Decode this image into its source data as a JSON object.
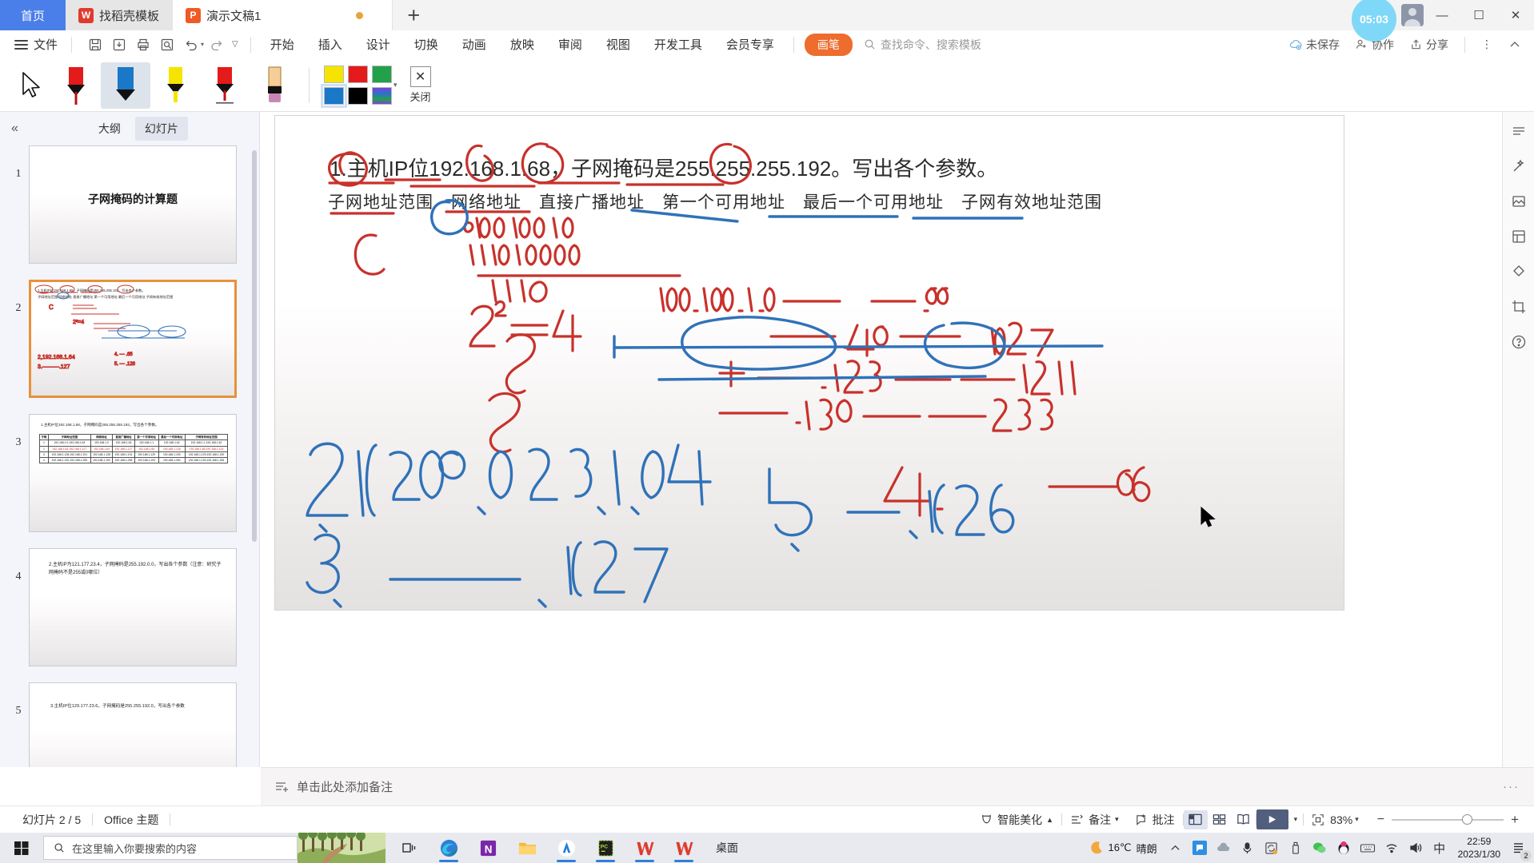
{
  "window": {
    "tabs": [
      {
        "label": "首页",
        "icon": "home-tab",
        "state": "home"
      },
      {
        "label": "找稻壳模板",
        "icon": "docer-icon",
        "state": "inactive"
      },
      {
        "label": "演示文稿1",
        "icon": "ppt-icon",
        "state": "active"
      }
    ],
    "new_tab_label": "+",
    "controls": {
      "minimize": "—",
      "maximize": "☐",
      "close": "✕"
    }
  },
  "menubar": {
    "file_label": "文件",
    "quick_access": [
      "save-icon",
      "save-as-icon",
      "print-icon",
      "print-preview-icon",
      "undo-icon",
      "redo-icon",
      "customize-icon"
    ],
    "items": [
      "开始",
      "插入",
      "设计",
      "切换",
      "动画",
      "放映",
      "审阅",
      "视图",
      "开发工具",
      "会员专享"
    ],
    "pen_tab": "画笔",
    "search_placeholder": "查找命令、搜索模板",
    "right_items": [
      {
        "label": "未保存",
        "icon": "cloud-unsaved-icon"
      },
      {
        "label": "协作",
        "icon": "collaborate-icon"
      },
      {
        "label": "分享",
        "icon": "share-icon"
      }
    ],
    "more_icon": "more-vertical-icon",
    "collapse_ribbon_icon": "chevron-up-icon"
  },
  "pen_ribbon": {
    "cursor_tool": "select-cursor",
    "pens": [
      {
        "name": "red-pen",
        "body": "#e51a1a",
        "tip": "#111111",
        "selected": false
      },
      {
        "name": "blue-highlighter",
        "body": "#1a78c8",
        "tip": "#111111",
        "selected": true
      },
      {
        "name": "yellow-highlighter",
        "body": "#f5e400",
        "tip": "#111111",
        "selected": false
      },
      {
        "name": "red-ballpoint",
        "body": "#e51a1a",
        "tip": "#111111",
        "selected": false
      },
      {
        "name": "eraser",
        "body": "#f5ce9a",
        "tip": "#c987b8",
        "selected": false
      }
    ],
    "colors": [
      {
        "name": "yellow",
        "hex": "#f5e400",
        "selected": false
      },
      {
        "name": "red",
        "hex": "#e51a1a",
        "selected": false
      },
      {
        "name": "green",
        "hex": "#22a14a",
        "selected": false
      },
      {
        "name": "blue",
        "hex": "#1a78c8",
        "selected": true
      },
      {
        "name": "black",
        "hex": "#000000",
        "selected": false
      },
      {
        "name": "rainbow",
        "hex": "#7a43d6",
        "selected": false
      }
    ],
    "more_colors_icon": "chevron-down-icon",
    "close_label": "关闭",
    "close_icon": "close-x-icon"
  },
  "left_panel": {
    "collapse_icon": "chevron-double-left-icon",
    "tabs": [
      {
        "label": "大纲",
        "active": false
      },
      {
        "label": "幻灯片",
        "active": true
      }
    ],
    "add_slide_label": "+",
    "slides": [
      {
        "number": "1",
        "selected": false,
        "title": "子网掩码的计算题",
        "kind": "title"
      },
      {
        "number": "2",
        "selected": true,
        "kind": "ink",
        "line1": "1.主机IP位192.168.1.68，子网掩码是255.255.255.192。写出各个参数。",
        "line2": "子网地址范围  网络地址  直接广播地址  第一个可用地址  最后一个可用地址  子网有效地址范围"
      },
      {
        "number": "3",
        "selected": false,
        "kind": "table",
        "heading": "1.主机IP位192.168.1.68，子网掩码是255.255.255.192。写出各个参数。",
        "columns": [
          "子网",
          "子网地址范围",
          "网络地址",
          "直接广播地址",
          "第一个可用地址",
          "最后一个可用地址",
          "子网有效地址范围"
        ],
        "rows": [
          [
            "1",
            "192.168.1.0-192.168.1.63",
            "192.168.1.0",
            "192.168.1.63",
            "192.168.1.1",
            "192.168.1.62",
            "192.168.1.1-192.168.1.62"
          ],
          [
            "2",
            "192.168.1.64-192.168.1.127",
            "192.168.1.64",
            "192.168.1.127",
            "192.168.1.65",
            "192.168.1.126",
            "192.168.1.65-192.168.1.126"
          ],
          [
            "3",
            "192.168.1.128-192.168.1.191",
            "192.168.1.128",
            "192.168.1.191",
            "192.168.1.129",
            "192.168.1.190",
            "192.168.1.129-192.168.1.190"
          ],
          [
            "4",
            "192.168.1.192-192.168.1.255",
            "192.168.1.192",
            "192.168.1.255",
            "192.168.1.193",
            "192.168.1.254",
            "192.168.1.193-192.168.1.254"
          ]
        ],
        "highlight_row_index": 1
      },
      {
        "number": "4",
        "selected": false,
        "kind": "text",
        "body": "2.主机IP为121.177.23.4，子网掩码是255.192.0.0，写出各个参数（注意：研究子网掩码不是255或0哪位）"
      },
      {
        "number": "5",
        "selected": false,
        "kind": "text",
        "body": "3.主机IP位129.177.23.6，子网掩码是255.255.192.0，写出各个参数"
      }
    ]
  },
  "slide": {
    "line1": "1.主机IP位192.168.1.68，子网掩码是255.255.255.192。写出各个参数。",
    "line2": "子网地址范围　网络地址　直接广播地址　第一个可用地址　最后一个可用地址　子网有效地址范围",
    "ink_notes": {
      "class_letter": "C",
      "binary_1": "01000100",
      "binary_2": "11000000",
      "power_expr": "2²=4",
      "range_top": "192.168.1.0 —  — .63",
      "mark_64": "— .64",
      "mark_127": ".127",
      "mark_128": "+ — .128 — — .191",
      "mark_192": "— .192 — — — .255",
      "answer2": "2,192.168.1.64",
      "answer3": "3. ——— .127",
      "answer4": "4.  ——— .65",
      "answer5": "5.  — .126"
    }
  },
  "right_rail": {
    "icons": [
      "panel-icon",
      "magic-wand-icon",
      "image-frame-icon",
      "layout-icon",
      "shapes-icon",
      "crop-icon",
      "help-icon"
    ]
  },
  "notes_bar": {
    "icon": "notes-icon",
    "placeholder": "单击此处添加备注",
    "more_icon": "more-horizontal-icon"
  },
  "status_bar": {
    "slide_counter": "幻灯片 2 / 5",
    "theme": "Office 主题",
    "beautify_label": "智能美化",
    "beautify_caret": "▲",
    "notes_label": "备注",
    "comment_label": "批注",
    "view_buttons": [
      {
        "name": "normal-view",
        "active": true
      },
      {
        "name": "slide-sorter-view",
        "active": false
      },
      {
        "name": "reading-view",
        "active": false
      }
    ],
    "play_icon": "play-icon",
    "fit_icon": "fit-to-window-icon",
    "zoom_level": "83%",
    "zoom_minus": "−",
    "zoom_plus": "+"
  },
  "taskbar": {
    "start_icon": "windows-start-icon",
    "search_placeholder": "在这里输入你要搜索的内容",
    "task_view_icon": "task-view-icon",
    "apps": [
      {
        "name": "edge-icon",
        "running": true
      },
      {
        "name": "onenote-icon",
        "running": false
      },
      {
        "name": "file-explorer-icon",
        "running": false
      },
      {
        "name": "app-blue-icon",
        "running": true
      },
      {
        "name": "pc-manager-icon",
        "running": true
      },
      {
        "name": "wps-writer-icon",
        "running": true
      },
      {
        "name": "wps-presentation-icon",
        "running": true
      }
    ],
    "desktop_label": "桌面",
    "weather_temp": "16℃",
    "weather_text": "晴朗",
    "tray_expand_icon": "chevron-up-icon",
    "tray_icons": [
      "chat-icon",
      "cloud-icon",
      "mic-icon",
      "sync-icon",
      "usb-icon",
      "wechat-icon",
      "qq-icon",
      "keyboard-icon",
      "wifi-icon",
      "volume-icon"
    ],
    "ime_label": "中",
    "clock_time": "22:59",
    "clock_date": "2023/1/30",
    "notification_icon": "notification-icon",
    "notification_count": "2"
  },
  "overlay": {
    "timer_label": "05:03",
    "avatar": "user-avatar"
  },
  "colors": {
    "accent_blue": "#4a7ee8",
    "pen_orange": "#ee6c2d",
    "selection_orange": "#e8913a",
    "ink_red": "#c8312b",
    "ink_blue": "#2f72b8",
    "panel_bg": "#f4f5fa"
  }
}
